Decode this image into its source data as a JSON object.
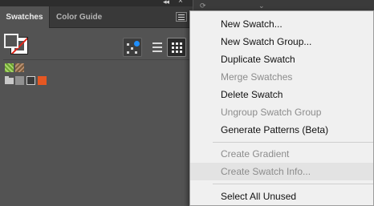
{
  "window": {
    "collapse_glyph": "◂◂",
    "close_glyph": "×"
  },
  "panel": {
    "tabs": [
      {
        "label": "Swatches",
        "active": true
      },
      {
        "label": "Color Guide",
        "active": false
      }
    ],
    "menu_icon": "hamburger-icon"
  },
  "fill_stroke": {
    "fill": "none",
    "stroke": "none",
    "none_slash_color": "#e0261b"
  },
  "view_buttons": [
    {
      "name": "show-color-groups",
      "icon": "color-group-icon"
    },
    {
      "name": "list-view",
      "icon": "list-icon"
    },
    {
      "name": "thumbnail-view",
      "icon": "grid-icon",
      "selected": true
    }
  ],
  "swatches": {
    "row1": [
      {
        "type": "pattern",
        "color": "#7fb23f"
      },
      {
        "type": "pattern",
        "color": "#9b7554"
      }
    ],
    "group_icon": "folder-icon",
    "row2": [
      {
        "type": "color",
        "color": "#919191"
      },
      {
        "type": "color",
        "color": "#3a3a3a",
        "selected": true
      },
      {
        "type": "color",
        "color": "#e55722"
      }
    ]
  },
  "menu": {
    "items": [
      {
        "label": "New Swatch...",
        "enabled": true
      },
      {
        "label": "New Swatch Group...",
        "enabled": true
      },
      {
        "label": "Duplicate Swatch",
        "enabled": true
      },
      {
        "label": "Merge Swatches",
        "enabled": false
      },
      {
        "label": "Delete Swatch",
        "enabled": true
      },
      {
        "label": "Ungroup Swatch Group",
        "enabled": false
      },
      {
        "label": "Generate Patterns (Beta)",
        "enabled": true
      },
      {
        "label": "Create Gradient",
        "enabled": false
      },
      {
        "label": "Create Swatch Info...",
        "enabled": false,
        "hovered": true
      },
      {
        "label": "Select All Unused",
        "enabled": true
      }
    ]
  }
}
